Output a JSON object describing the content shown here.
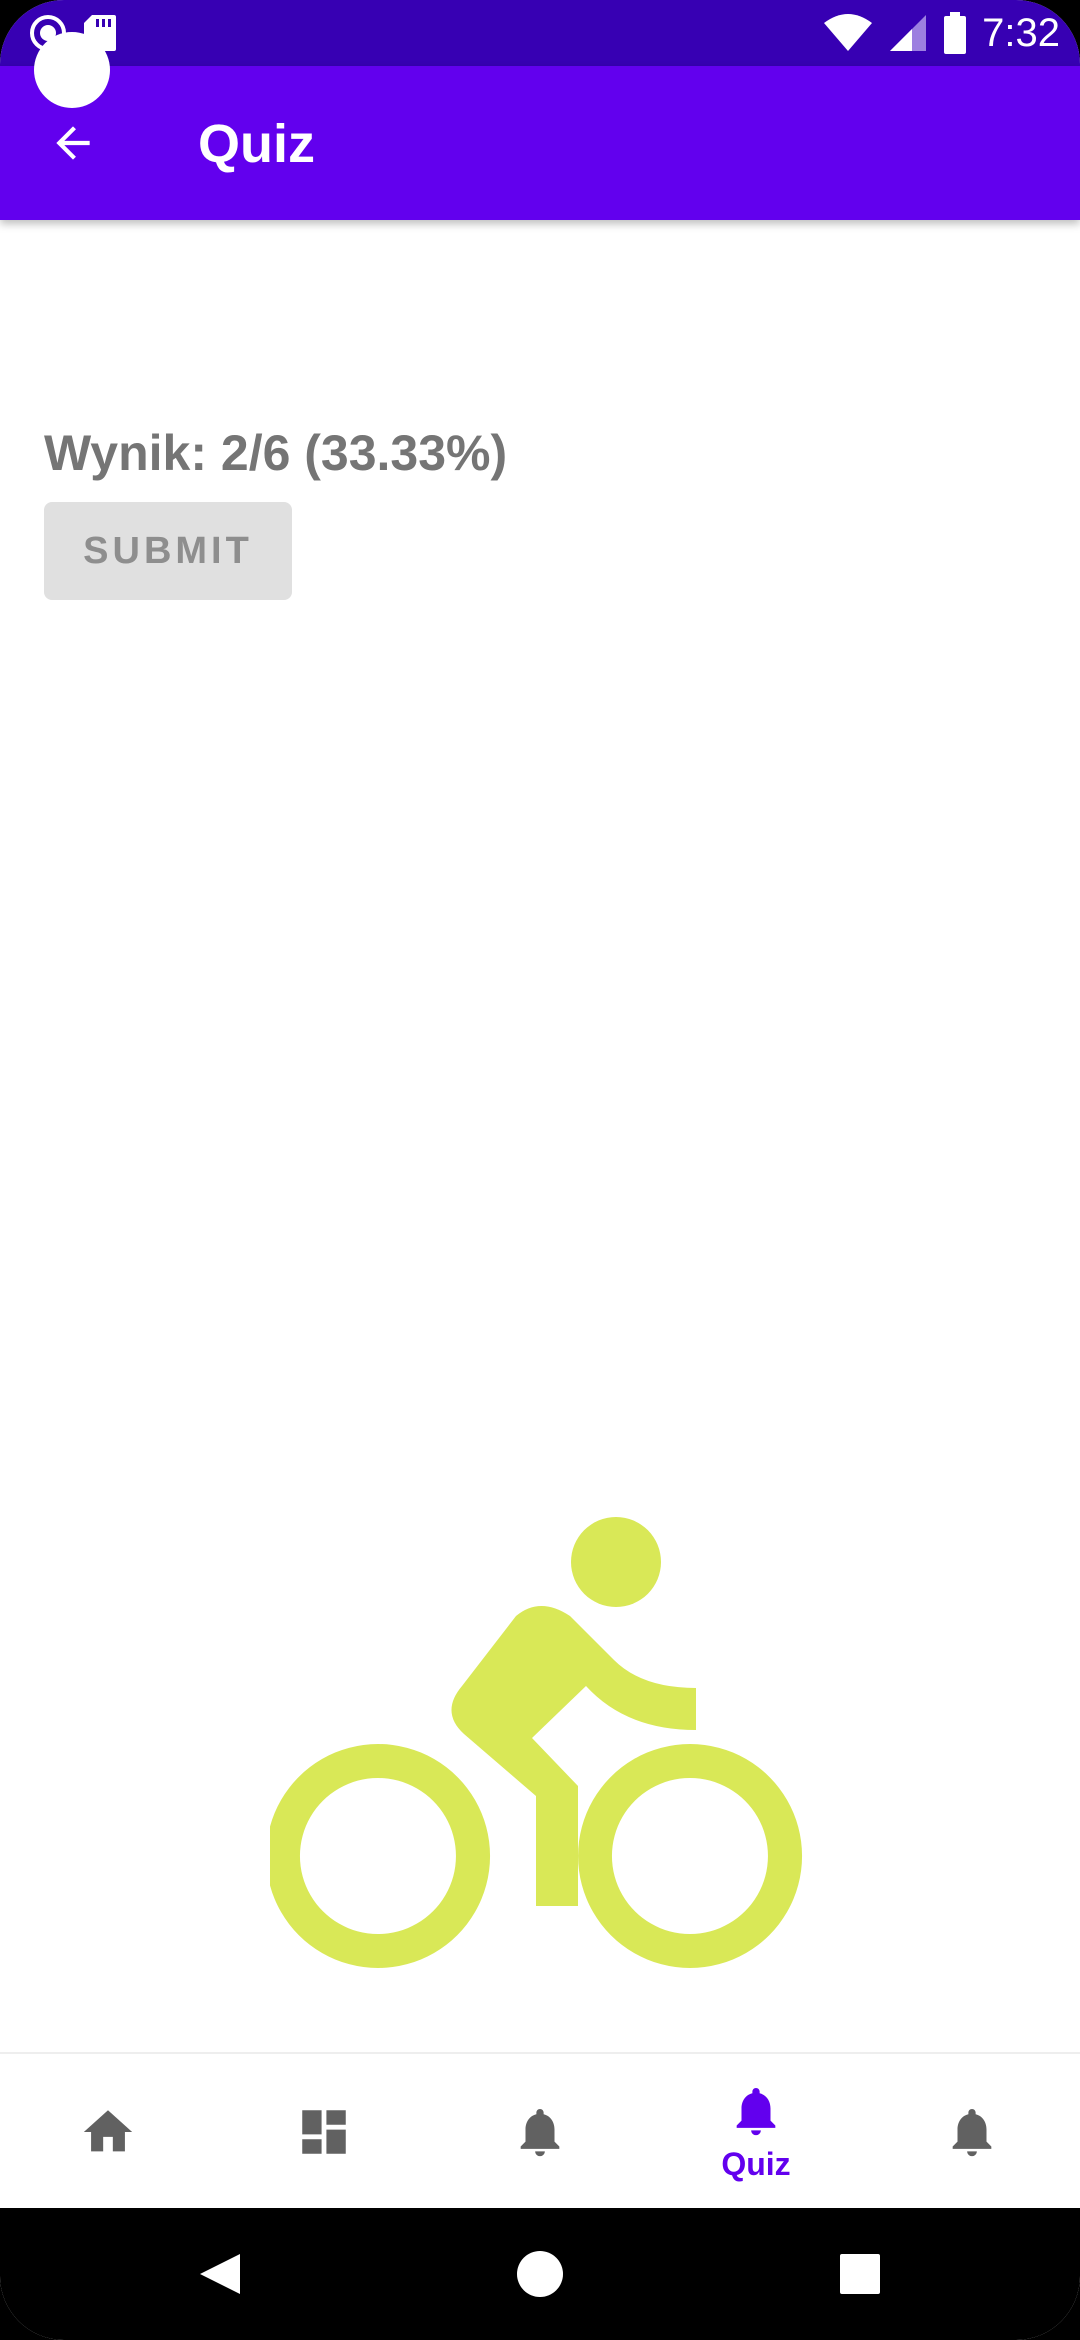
{
  "status_bar": {
    "time": "7:32",
    "icons": [
      "record-icon",
      "sd-card-icon",
      "wifi-icon",
      "signal-icon",
      "battery-icon"
    ]
  },
  "toolbar": {
    "title": "Quiz",
    "back_icon": "arrow-back-icon"
  },
  "content": {
    "score_text": "Wynik: 2/6 (33.33%)",
    "submit_label": "SUBMIT",
    "illustration": "bike-icon",
    "illustration_color": "#d9e857"
  },
  "bottom_nav": {
    "items": [
      {
        "icon": "home-icon",
        "label": "",
        "active": false
      },
      {
        "icon": "dashboard-icon",
        "label": "",
        "active": false
      },
      {
        "icon": "bell-icon",
        "label": "",
        "active": false
      },
      {
        "icon": "bell-icon",
        "label": "Quiz",
        "active": true
      },
      {
        "icon": "bell-icon",
        "label": "",
        "active": false
      }
    ]
  },
  "colors": {
    "primary": "#6200ee",
    "primary_dark": "#3700b3",
    "inactive_icon": "#616161",
    "score_text": "#757575"
  }
}
